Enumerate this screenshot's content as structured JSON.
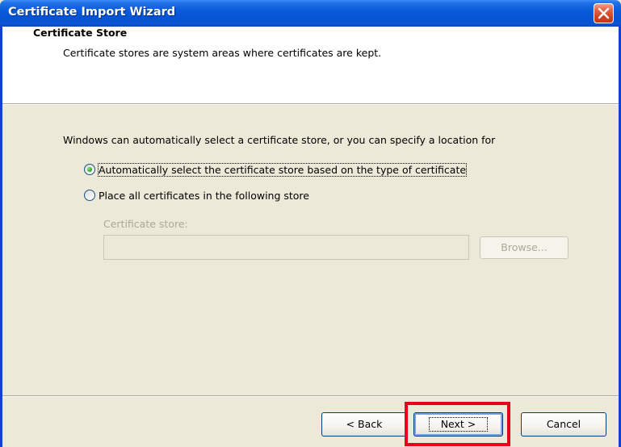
{
  "window": {
    "title": "Certificate Import Wizard"
  },
  "header": {
    "title": "Certificate Store",
    "subtitle": "Certificate stores are system areas where certificates are kept."
  },
  "body": {
    "intro": "Windows can automatically select a certificate store, or you can specify a location for",
    "options": [
      {
        "label": "Automatically select the certificate store based on the type of certificate",
        "checked": true
      },
      {
        "label": "Place all certificates in the following store",
        "checked": false
      }
    ],
    "store_label": "Certificate store:",
    "store_value": "",
    "browse_label": "Browse..."
  },
  "footer": {
    "back_label": "< Back",
    "next_label": "Next >",
    "cancel_label": "Cancel"
  },
  "colors": {
    "highlight": "#e8001a",
    "titlebar": "#0653d6"
  },
  "icons": {
    "close": "close-icon"
  }
}
